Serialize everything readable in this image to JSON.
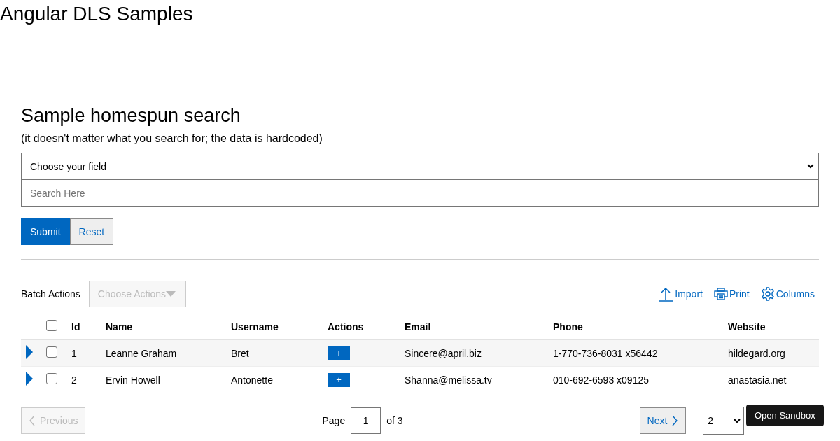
{
  "page_title": "Angular DLS Samples",
  "search": {
    "heading": "Sample homespun search",
    "note": "(it doesn't matter what you search for; the data is hardcoded)",
    "field_select": "Choose your field",
    "placeholder": "Search Here",
    "buttons": [
      {
        "label": "Submit",
        "kind": "primary"
      },
      {
        "label": "Reset",
        "kind": "secondary"
      }
    ]
  },
  "toolbar": {
    "batch_label": "Batch Actions",
    "batch_select": {
      "label": "Choose Actions",
      "disabled": true
    },
    "actions": [
      {
        "label": "Import",
        "kind": "import"
      },
      {
        "label": "Print",
        "kind": "print"
      },
      {
        "label": "Columns",
        "kind": "columns"
      }
    ]
  },
  "table": {
    "select_all_checked": false,
    "columns": [
      "Id",
      "Name",
      "Username",
      "Actions",
      "Email",
      "Phone",
      "Website"
    ],
    "rows": [
      {
        "expanded": false,
        "checked": false,
        "cells": [
          "1",
          "Leanne Graham",
          "Bret",
          "+",
          "Sincere@april.biz",
          "1-770-736-8031 x56442",
          "hildegard.org"
        ]
      },
      {
        "expanded": false,
        "checked": false,
        "cells": [
          "2",
          "Ervin Howell",
          "Antonette",
          "+",
          "Shanna@melissa.tv",
          "010-692-6593 x09125",
          "anastasia.net"
        ]
      }
    ]
  },
  "pagination": {
    "previous": {
      "label": "Previous",
      "disabled": true
    },
    "page_label": "Page",
    "page": "1",
    "of": "of 3",
    "next": {
      "label": "Next",
      "disabled": false
    },
    "page_size": "2"
  },
  "tooltip": "Open Sandbox"
}
